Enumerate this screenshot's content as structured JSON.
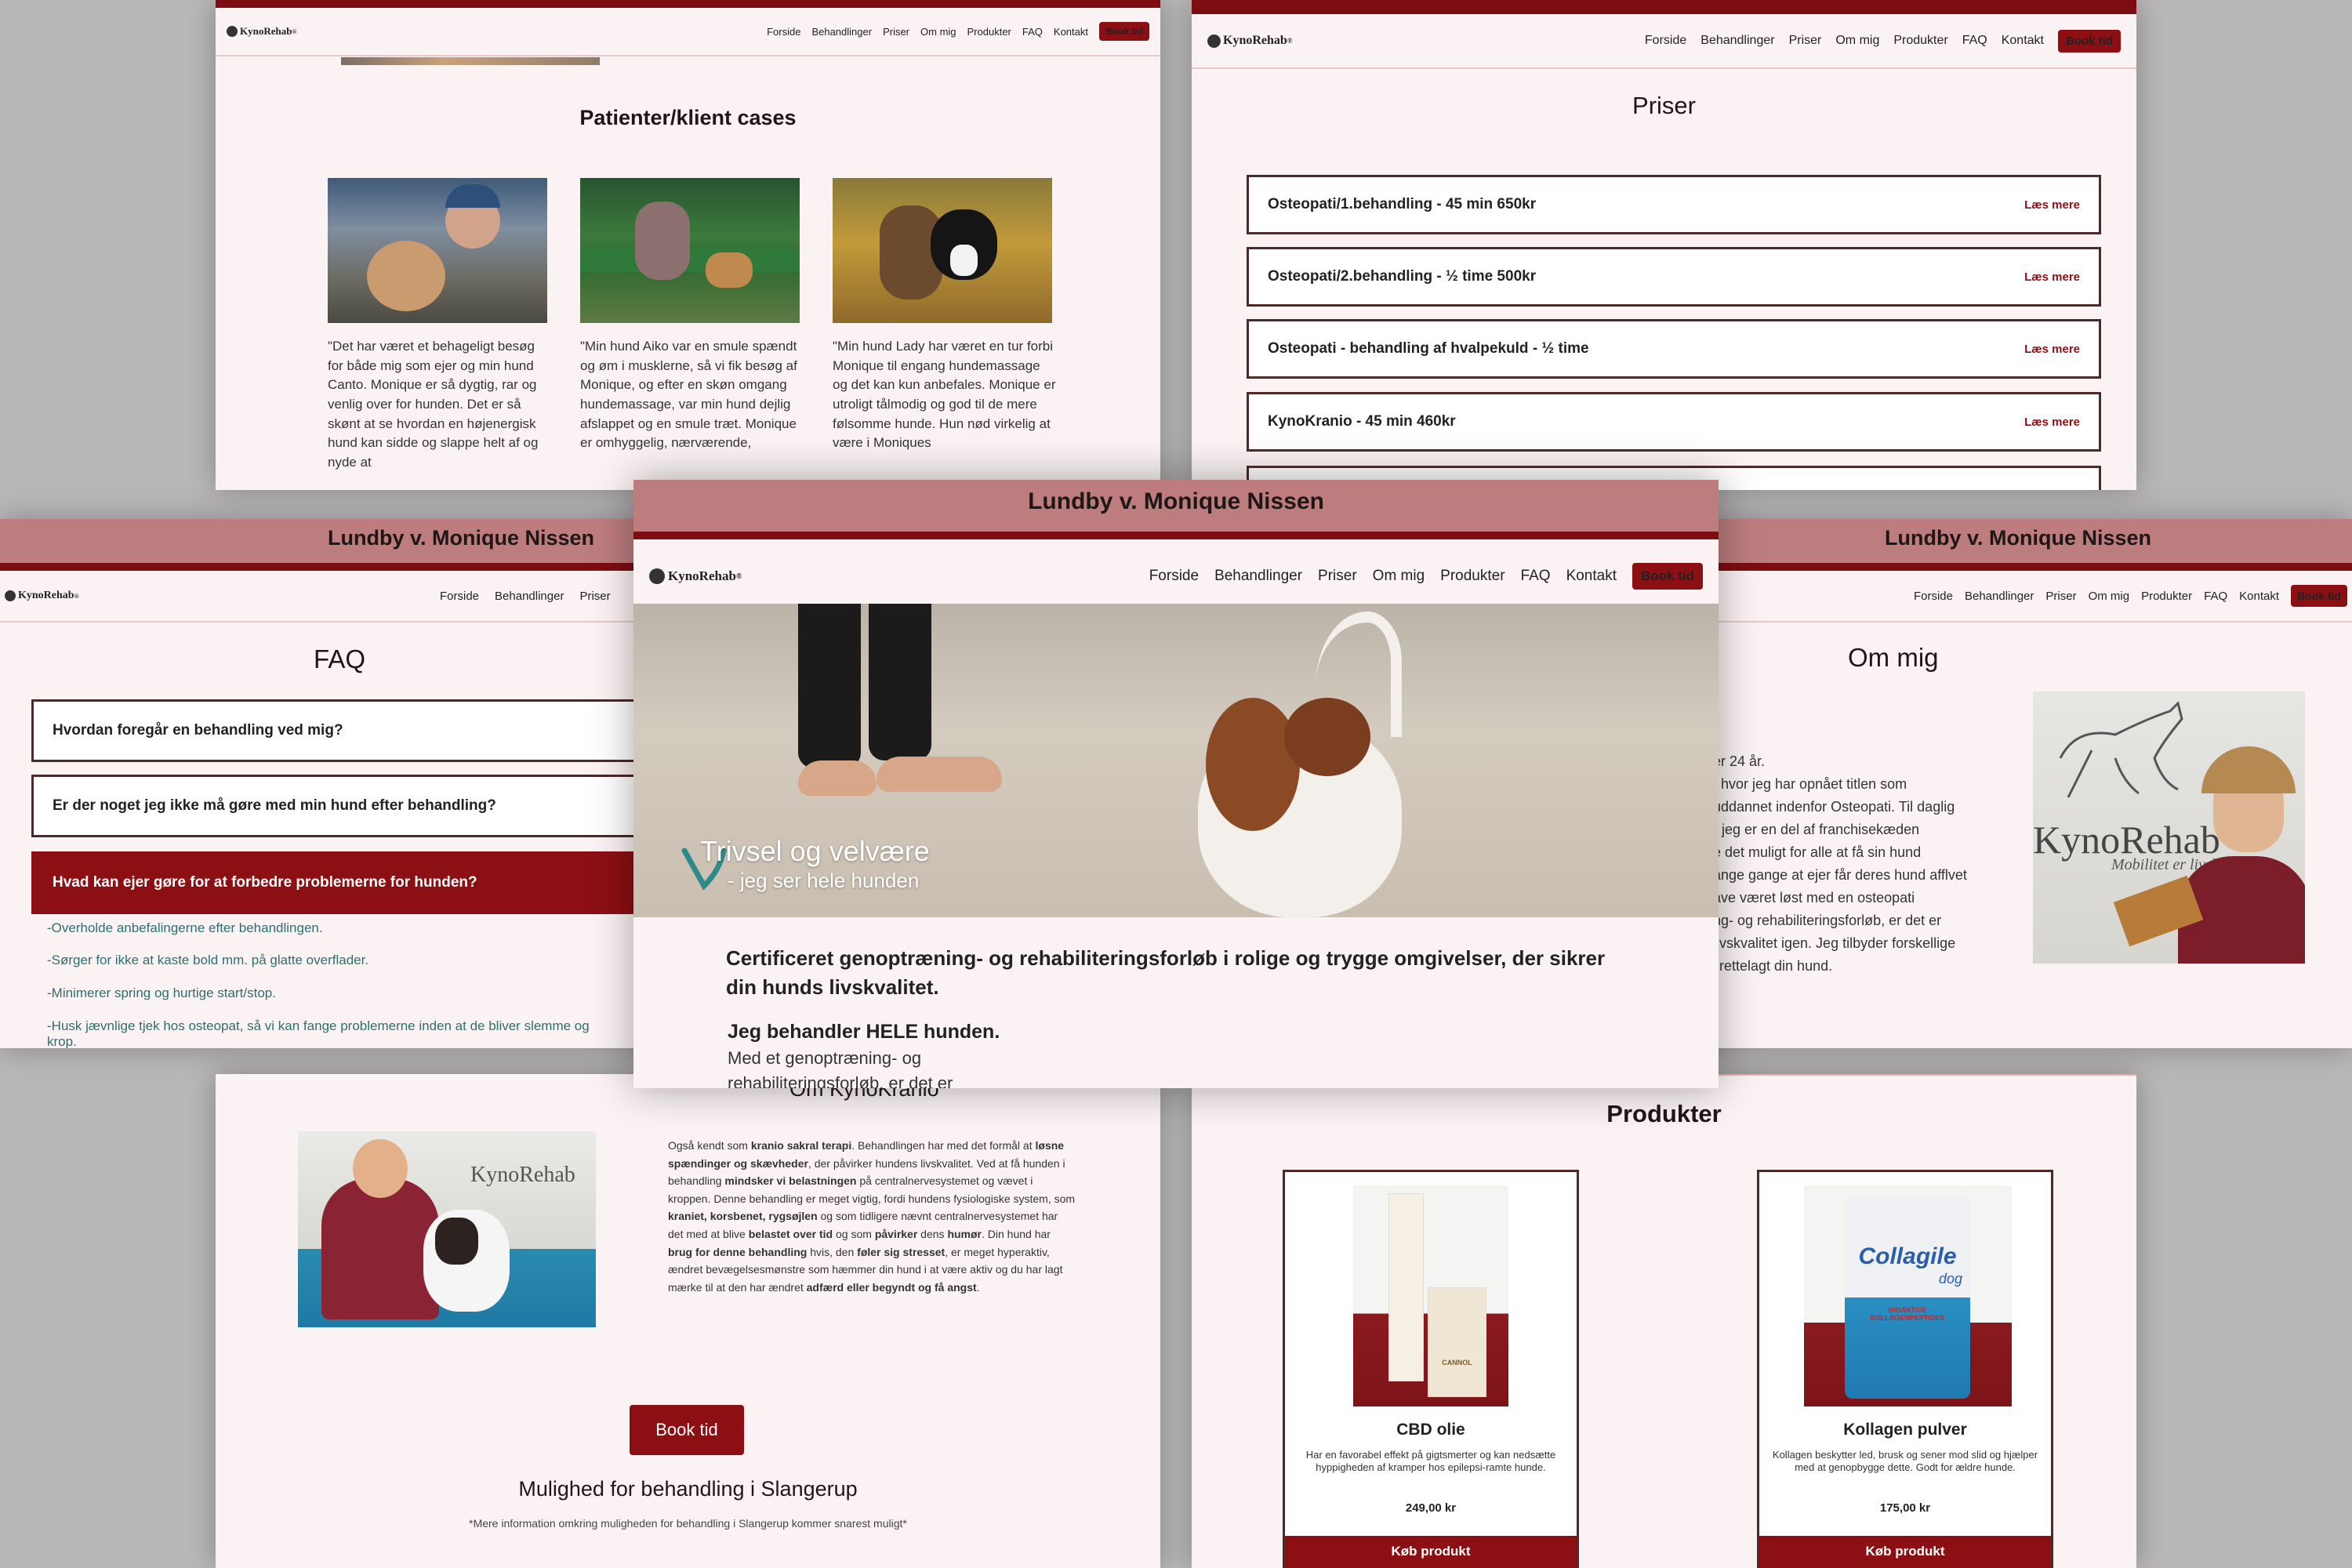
{
  "brand": {
    "logo_text": "KynoRehab",
    "logo_tm": "®",
    "site_title": "Lundby v. Monique Nissen"
  },
  "nav": [
    "Forside",
    "Behandlinger",
    "Priser",
    "Om mig",
    "Produkter",
    "FAQ",
    "Kontakt"
  ],
  "nav_short": [
    "Forside",
    "Behandlinger",
    "Priser"
  ],
  "book_label": "Book tid",
  "cases": {
    "title": "Patienter/klient cases",
    "items": [
      {
        "text": "\"Det har været et behageligt besøg for både mig som ejer og min hund Canto. Monique er så dygtig, rar og venlig over for hunden. Det er så skønt at se hvordan en højenergisk hund kan sidde og slappe helt af og nyde at"
      },
      {
        "text": "\"Min hund Aiko var en smule spændt og øm i musklerne, så vi fik besøg af Monique, og efter en skøn omgang hundemassage, var min hund dejlig afslappet og en smule træt. Monique er omhyggelig, nærværende,"
      },
      {
        "text": "\"Min hund Lady har været en tur forbi Monique til engang hundemassage og det kan kun anbefales. Monique er utroligt tålmodig og god til de mere følsomme hunde. Hun nød virkelig at være i Moniques"
      }
    ]
  },
  "prices": {
    "title": "Priser",
    "more_label": "Læs mere",
    "items": [
      "Osteopati/1.behandling - 45 min 650kr",
      "Osteopati/2.behandling - ½ time 500kr",
      "Osteopati - behandling af hvalpekuld - ½ time",
      "KynoKranio - 45 min 460kr"
    ]
  },
  "faq": {
    "title": "FAQ",
    "questions": [
      "Hvordan foregår en behandling ved mig?",
      "Er der noget jeg ikke må gøre med min hund efter behandling?",
      "Hvad kan ejer gøre for at forbedre problemerne for hunden?"
    ],
    "answers": [
      "-Overholde anbefalingerne efter behandlingen.",
      "-Sørger for ikke at kaste bold mm. på glatte overflader.",
      "-Minimerer spring og hurtige start/stop.",
      "-Husk jævnlige tjek hos osteopat, så vi kan fange problemerne inden at de bliver slemme og",
      "krop."
    ]
  },
  "hero": {
    "overlay_title": "Trivsel og velvære",
    "overlay_sub": "- jeg ser hele hunden",
    "headline": "Certificeret genoptræning- og rehabiliteringsforløb i rolige og trygge omgivelser, der sikrer din hunds livskvalitet.",
    "subhead": "Jeg behandler HELE hunden.",
    "body_line1": "Med et genoptræning- og",
    "body_line2": "rehabiliteringsforløb, er det er"
  },
  "about": {
    "title": "Om mig",
    "lines": [
      "er 24 år.",
      ", hvor jeg har opnået titlen som",
      "uddannet indenfor Osteopati. Til daglig",
      "r jeg er en del af franchisekæden",
      "e det muligt for alle at få sin hund",
      "ange gange at ejer får deres hund afflvet",
      "ave været løst med en osteopati",
      "ng- og rehabiliteringsforløb, er det er",
      "livskvalitet igen. Jeg tilbyder forskellige",
      "ilrettelagt din hund."
    ],
    "wall_brand": "KynoRehab",
    "wall_slogan": "Mobilitet er livskvalitet"
  },
  "kranio": {
    "title": "Om KynoKranio",
    "rich": "Også kendt som <b>kranio sakral terapi</b>. Behandlingen har med det formål at <b>løsne spændinger og skævheder</b>, der påvirker hundens livskvalitet. Ved at få hunden i behandling <b>mindsker vi belastningen</b> på centralnervesystemet og vævet i kroppen. Denne behandling er meget vigtig, fordi hundens fysiologiske system, som <b>kraniet, korsbenet, rygsøjlen</b> og som tidligere nævnt centralnervesystemet har det med at blive <b>belastet over tid</b> og som <b>påvirker</b> dens <b>humør</b>. Din hund har <b>brug for denne behandling</b> hvis, den <b>føler sig stresset</b>, er meget hyperaktiv, ændret bevægelsesmønstre som hæmmer din hund i at være aktiv og du har lagt mærke til at den har ændret <b>adfærd eller begyndt og få angst</b>.",
    "book_label": "Book tid",
    "slangerup_title": "Mulighed for behandling i Slangerup",
    "slangerup_note": "*Mere information omkring muligheden for behandling i Slangerup kommer snarest muligt*",
    "wall_brand": "KynoRehab"
  },
  "products": {
    "title": "Produkter",
    "buy_label": "Køb produkt",
    "items": [
      {
        "name": "CBD olie",
        "desc": "Har en favorabel effekt på gigtsmerter og kan nedsætte hyppigheden af kramper hos epilepsi-ramte hunde.",
        "price": "249,00 kr",
        "pkg": "CANNOL"
      },
      {
        "name": "Kollagen pulver",
        "desc": "Kollagen beskytter led, brusk og sener mod slid og hjælper med at genopbygge dette. Godt for ældre hunde.",
        "price": "175,00 kr",
        "pkg_brand": "Collagile",
        "pkg_sub": "dog",
        "pkg_band": "BIOAKTIVE KOLLAGENPEPTIDER"
      }
    ]
  },
  "colors": {
    "accent": "#8c0f14",
    "band": "#bd7d7e",
    "bg": "#fbf3f3"
  }
}
